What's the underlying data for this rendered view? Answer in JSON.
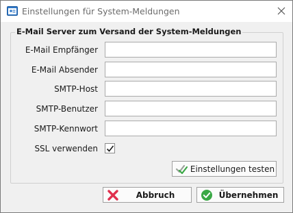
{
  "window": {
    "title": "Einstellungen für System-Meldungen"
  },
  "group": {
    "title": "E-Mail Server zum Versand der System-Meldungen"
  },
  "fields": {
    "recipient": {
      "label": "E-Mail Empfänger",
      "value": ""
    },
    "sender": {
      "label": "E-Mail Absender",
      "value": ""
    },
    "smtp_host": {
      "label": "SMTP-Host",
      "value": ""
    },
    "smtp_user": {
      "label": "SMTP-Benutzer",
      "value": ""
    },
    "smtp_password": {
      "label": "SMTP-Kennwort",
      "value": ""
    }
  },
  "ssl": {
    "label": "SSL verwenden",
    "checked": true
  },
  "buttons": {
    "test": "Einstellungen testen",
    "cancel": "Abbruch",
    "apply": "Übernehmen"
  },
  "colors": {
    "accent_green": "#3aa845",
    "cancel_red": "#e0304e",
    "app_icon_blue": "#2f78c8"
  }
}
